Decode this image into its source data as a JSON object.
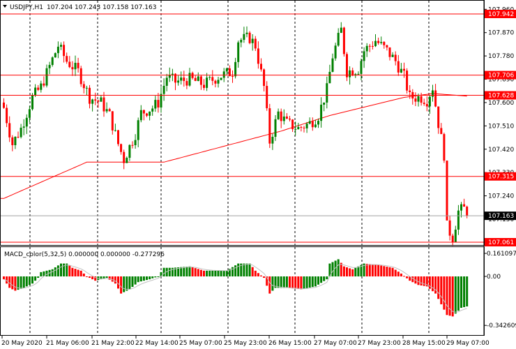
{
  "header": {
    "symbol": "USDJPY,H1",
    "ohlc": "107.204 107.243 107.158 107.163",
    "menu_icon": "triangle-down-icon"
  },
  "indicator": {
    "label": "MACD_color(5,32,5) 0.000000 0.000000 -0.277296"
  },
  "colors": {
    "bull": "#008000",
    "bear": "#ff0000",
    "ma": "#ff0000",
    "signal": "#c0c0c0",
    "grid": "#000000",
    "level": "#ff0000",
    "bid": "#000000"
  },
  "chart_data": {
    "type": "candlestick",
    "price_range": [
      107.061,
      107.942
    ],
    "price_ticks": [
      "107.960",
      "107.870",
      "107.780",
      "107.690",
      "107.600",
      "107.510",
      "107.420",
      "107.330",
      "107.240",
      "107.150"
    ],
    "levels": [
      {
        "price": 107.942,
        "label": "107.942"
      },
      {
        "price": 107.706,
        "label": "107.706"
      },
      {
        "price": 107.628,
        "label": "107.628"
      },
      {
        "price": 107.315,
        "label": "107.315"
      },
      {
        "price": 107.061,
        "label": "107.061"
      }
    ],
    "bid": {
      "price": 107.163,
      "label": "107.163"
    },
    "time_labels": [
      "20 May 2020",
      "21 May 06:00",
      "21 May 22:00",
      "22 May 14:00",
      "25 May 07:00",
      "25 May 23:00",
      "26 May 15:00",
      "27 May 07:00",
      "27 May 23:00",
      "28 May 15:00",
      "29 May 07:00"
    ],
    "bar_count": 163,
    "close_anchors": [
      [
        0,
        107.58
      ],
      [
        3,
        107.44
      ],
      [
        6,
        107.5
      ],
      [
        10,
        107.62
      ],
      [
        13,
        107.66
      ],
      [
        16,
        107.74
      ],
      [
        19,
        107.82
      ],
      [
        22,
        107.76
      ],
      [
        26,
        107.72
      ],
      [
        30,
        107.62
      ],
      [
        34,
        107.6
      ],
      [
        37,
        107.55
      ],
      [
        40,
        107.44
      ],
      [
        42,
        107.38
      ],
      [
        46,
        107.48
      ],
      [
        48,
        107.56
      ],
      [
        52,
        107.58
      ],
      [
        54,
        107.6
      ],
      [
        57,
        107.7
      ],
      [
        60,
        107.68
      ],
      [
        65,
        107.69
      ],
      [
        70,
        107.67
      ],
      [
        75,
        107.7
      ],
      [
        80,
        107.72
      ],
      [
        82,
        107.84
      ],
      [
        86,
        107.85
      ],
      [
        88,
        107.82
      ],
      [
        91,
        107.66
      ],
      [
        93,
        107.45
      ],
      [
        96,
        107.56
      ],
      [
        99,
        107.52
      ],
      [
        103,
        107.5
      ],
      [
        107,
        107.52
      ],
      [
        110,
        107.55
      ],
      [
        113,
        107.65
      ],
      [
        115,
        107.78
      ],
      [
        118,
        107.88
      ],
      [
        120,
        107.72
      ],
      [
        124,
        107.73
      ],
      [
        126,
        107.8
      ],
      [
        130,
        107.84
      ],
      [
        134,
        107.8
      ],
      [
        137,
        107.76
      ],
      [
        140,
        107.7
      ],
      [
        142,
        107.62
      ],
      [
        146,
        107.62
      ],
      [
        148,
        107.61
      ],
      [
        150,
        107.66
      ],
      [
        152,
        107.52
      ],
      [
        154,
        107.4
      ],
      [
        155,
        107.12
      ],
      [
        157,
        107.08
      ],
      [
        159,
        107.18
      ],
      [
        161,
        107.19
      ],
      [
        162,
        107.163
      ]
    ],
    "ma_anchors": [
      [
        0,
        107.23
      ],
      [
        29,
        107.37
      ],
      [
        56,
        107.37
      ],
      [
        97,
        107.49
      ],
      [
        114,
        107.55
      ],
      [
        140,
        107.62
      ],
      [
        150,
        107.635
      ],
      [
        162,
        107.625
      ]
    ],
    "macd": {
      "range": [
        -0.342609,
        0.161097
      ],
      "ticks": [
        "0.161097",
        "0.00",
        "-0.342609"
      ],
      "anchors": [
        [
          0,
          -0.02
        ],
        [
          2,
          -0.08
        ],
        [
          4,
          -0.1
        ],
        [
          7,
          -0.08
        ],
        [
          10,
          -0.05
        ],
        [
          12,
          -0.01
        ],
        [
          13,
          0.03
        ],
        [
          17,
          0.05
        ],
        [
          20,
          0.09
        ],
        [
          22,
          0.09
        ],
        [
          24,
          0.06
        ],
        [
          27,
          0.04
        ],
        [
          29,
          0.0
        ],
        [
          32,
          -0.03
        ],
        [
          34,
          -0.02
        ],
        [
          36,
          -0.01
        ],
        [
          39,
          -0.05
        ],
        [
          41,
          -0.12
        ],
        [
          44,
          -0.09
        ],
        [
          47,
          -0.04
        ],
        [
          51,
          -0.02
        ],
        [
          54,
          0.0
        ],
        [
          56,
          0.06
        ],
        [
          59,
          0.06
        ],
        [
          65,
          0.07
        ],
        [
          70,
          0.04
        ],
        [
          78,
          0.04
        ],
        [
          82,
          0.09
        ],
        [
          86,
          0.09
        ],
        [
          88,
          0.04
        ],
        [
          91,
          -0.01
        ],
        [
          93,
          -0.12
        ],
        [
          95,
          -0.08
        ],
        [
          99,
          -0.08
        ],
        [
          104,
          -0.09
        ],
        [
          109,
          -0.07
        ],
        [
          113,
          -0.02
        ],
        [
          114,
          0.09
        ],
        [
          117,
          0.12
        ],
        [
          119,
          0.07
        ],
        [
          122,
          0.05
        ],
        [
          126,
          0.09
        ],
        [
          131,
          0.08
        ],
        [
          136,
          0.06
        ],
        [
          139,
          0.02
        ],
        [
          142,
          -0.03
        ],
        [
          145,
          -0.06
        ],
        [
          148,
          -0.07
        ],
        [
          151,
          -0.12
        ],
        [
          155,
          -0.27
        ],
        [
          157,
          -0.28
        ],
        [
          160,
          -0.22
        ],
        [
          162,
          -0.21
        ]
      ]
    }
  }
}
